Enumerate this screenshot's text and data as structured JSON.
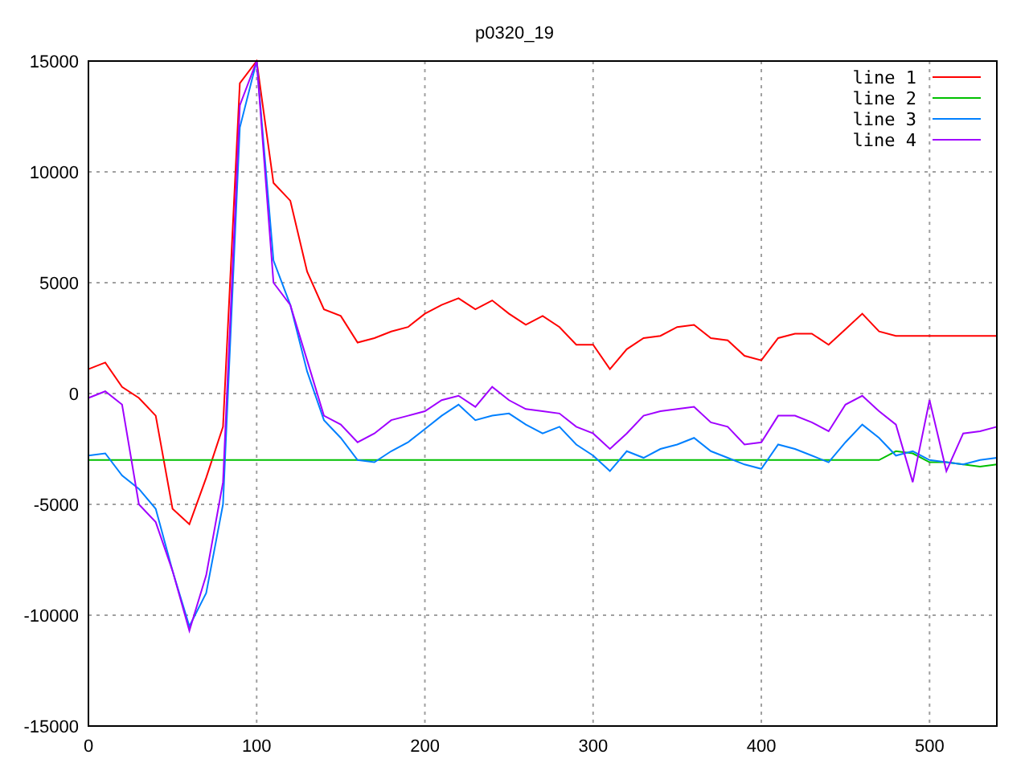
{
  "chart_data": {
    "type": "line",
    "title": "p0320_19",
    "x": [
      0,
      10,
      20,
      30,
      40,
      50,
      60,
      70,
      80,
      90,
      100,
      110,
      120,
      130,
      140,
      150,
      160,
      170,
      180,
      190,
      200,
      210,
      220,
      230,
      240,
      250,
      260,
      270,
      280,
      290,
      300,
      310,
      320,
      330,
      340,
      350,
      360,
      370,
      380,
      390,
      400,
      410,
      420,
      430,
      440,
      450,
      460,
      470,
      480,
      490,
      500,
      510,
      520,
      530,
      540
    ],
    "series": [
      {
        "name": "line 1",
        "color": "#ff0000",
        "values": [
          1100,
          1400,
          300,
          -200,
          -1000,
          -5200,
          -5900,
          -3800,
          -1500,
          14000,
          15000,
          9500,
          8700,
          5500,
          3800,
          3500,
          2300,
          2500,
          2800,
          3000,
          3600,
          4000,
          4300,
          3800,
          4200,
          3600,
          3100,
          3500,
          3000,
          2200,
          2200,
          1100,
          2000,
          2500,
          2600,
          3000,
          3100,
          2500,
          2400,
          1700,
          1500,
          2500,
          2700,
          2700,
          2200,
          2900,
          3600,
          2800,
          2600,
          2600,
          2600,
          2600,
          2600,
          2600,
          2600
        ]
      },
      {
        "name": "line 2",
        "color": "#00c000",
        "values": [
          -3000,
          -3000,
          -3000,
          -3000,
          -3000,
          -3000,
          -3000,
          -3000,
          -3000,
          -3000,
          -3000,
          -3000,
          -3000,
          -3000,
          -3000,
          -3000,
          -3000,
          -3000,
          -3000,
          -3000,
          -3000,
          -3000,
          -3000,
          -3000,
          -3000,
          -3000,
          -3000,
          -3000,
          -3000,
          -3000,
          -3000,
          -3000,
          -3000,
          -3000,
          -3000,
          -3000,
          -3000,
          -3000,
          -3000,
          -3000,
          -3000,
          -3000,
          -3000,
          -3000,
          -3000,
          -3000,
          -3000,
          -3000,
          -2600,
          -2700,
          -3100,
          -3100,
          -3200,
          -3300,
          -3200
        ]
      },
      {
        "name": "line 3",
        "color": "#0080ff",
        "values": [
          -2800,
          -2700,
          -3700,
          -4300,
          -5200,
          -8000,
          -10500,
          -9000,
          -5000,
          12000,
          15000,
          6000,
          4000,
          1000,
          -1200,
          -2000,
          -3000,
          -3100,
          -2600,
          -2200,
          -1600,
          -1000,
          -500,
          -1200,
          -1000,
          -900,
          -1400,
          -1800,
          -1500,
          -2300,
          -2800,
          -3500,
          -2600,
          -2900,
          -2500,
          -2300,
          -2000,
          -2600,
          -2900,
          -3200,
          -3400,
          -2300,
          -2500,
          -2800,
          -3100,
          -2200,
          -1400,
          -2000,
          -2800,
          -2600,
          -3000,
          -3100,
          -3200,
          -3000,
          -2900
        ]
      },
      {
        "name": "line 4",
        "color": "#a000ff",
        "values": [
          -200,
          100,
          -500,
          -5000,
          -5800,
          -8000,
          -10700,
          -8200,
          -4000,
          13000,
          15000,
          5000,
          4000,
          1500,
          -1000,
          -1400,
          -2200,
          -1800,
          -1200,
          -1000,
          -800,
          -300,
          -100,
          -600,
          300,
          -300,
          -700,
          -800,
          -900,
          -1500,
          -1800,
          -2500,
          -1800,
          -1000,
          -800,
          -700,
          -600,
          -1300,
          -1500,
          -2300,
          -2200,
          -1000,
          -1000,
          -1300,
          -1700,
          -500,
          -100,
          -800,
          -1400,
          -4000,
          -300,
          -3500,
          -1800,
          -1700,
          -1500
        ]
      }
    ],
    "xlim": [
      0,
      540
    ],
    "ylim": [
      -15000,
      15000
    ],
    "xticks": [
      0,
      100,
      200,
      300,
      400,
      500
    ],
    "yticks": [
      -15000,
      -10000,
      -5000,
      0,
      5000,
      10000,
      15000
    ],
    "grid": true,
    "legend": true
  }
}
